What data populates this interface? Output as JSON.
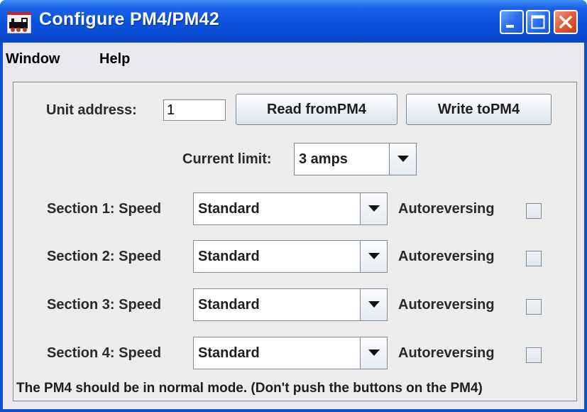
{
  "window": {
    "title": "Configure PM4/PM42",
    "title_bar_color": "#0b4fd4",
    "close_button_color": "#e25a34"
  },
  "menubar": {
    "items": [
      {
        "label": "Window"
      },
      {
        "label": "Help"
      }
    ]
  },
  "address": {
    "label": "Unit address:",
    "value": "1"
  },
  "buttons": {
    "read_label": "Read fromPM4",
    "write_label": "Write toPM4"
  },
  "current_limit": {
    "label": "Current limit:",
    "selected": "3 amps"
  },
  "sections": [
    {
      "label": "Section 1: Speed",
      "speed": "Standard",
      "autoreverse_label": "Autoreversing",
      "autoreverse_checked": false
    },
    {
      "label": "Section 2: Speed",
      "speed": "Standard",
      "autoreverse_label": "Autoreversing",
      "autoreverse_checked": false
    },
    {
      "label": "Section 3: Speed",
      "speed": "Standard",
      "autoreverse_label": "Autoreversing",
      "autoreverse_checked": false
    },
    {
      "label": "Section 4: Speed",
      "speed": "Standard",
      "autoreverse_label": "Autoreversing",
      "autoreverse_checked": false
    }
  ],
  "footer": {
    "note": "The PM4 should be in normal mode. (Don't push the buttons on the PM4)"
  }
}
